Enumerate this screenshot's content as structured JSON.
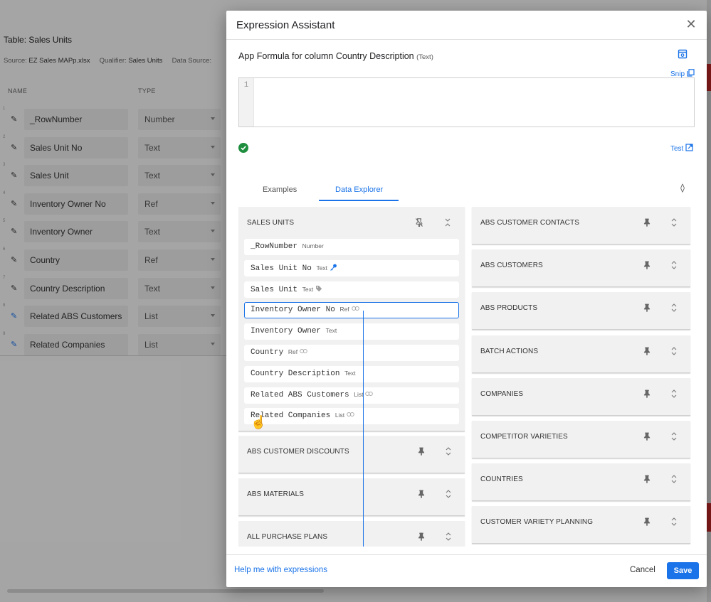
{
  "background": {
    "table_title": "Table: Sales Units",
    "source_label": "Source:",
    "source_value": "EZ Sales MAPp.xlsx",
    "qualifier_label": "Qualifier:",
    "qualifier_value": "Sales Units",
    "data_source_label": "Data Source:",
    "columns_header": {
      "name": "NAME",
      "type": "TYPE"
    },
    "rows": [
      {
        "index": "1",
        "name": "_RowNumber",
        "type": "Number",
        "edit_icon": "pencil-icon"
      },
      {
        "index": "2",
        "name": "Sales Unit No",
        "type": "Text",
        "edit_icon": "pencil-icon"
      },
      {
        "index": "3",
        "name": "Sales Unit",
        "type": "Text",
        "edit_icon": "pencil-icon"
      },
      {
        "index": "4",
        "name": "Inventory Owner No",
        "type": "Ref",
        "edit_icon": "pencil-icon"
      },
      {
        "index": "5",
        "name": "Inventory Owner",
        "type": "Text",
        "edit_icon": "pencil-icon"
      },
      {
        "index": "6",
        "name": "Country",
        "type": "Ref",
        "edit_icon": "pencil-icon"
      },
      {
        "index": "7",
        "name": "Country Description",
        "type": "Text",
        "edit_icon": "pencil-icon"
      },
      {
        "index": "8",
        "name": "Related ABS Customers",
        "type": "List",
        "edit_icon": "pencil-icon-blue"
      },
      {
        "index": "9",
        "name": "Related Companies",
        "type": "List",
        "edit_icon": "pencil-icon-blue"
      }
    ]
  },
  "dialog": {
    "title": "Expression Assistant",
    "close_icon": "close-icon",
    "formula_label": "App Formula for column Country Description",
    "formula_type": "(Text)",
    "snip_label": "Snip",
    "editor_line_number": "1",
    "editor_value": "",
    "status_icon": "check-circle-icon",
    "test_label": "Test",
    "tabs": [
      {
        "label": "Examples",
        "active": false
      },
      {
        "label": "Data Explorer",
        "active": true
      }
    ],
    "collapse_all_icon": "collapse-all-icon",
    "explorer": {
      "left_tables": [
        {
          "title": "SALES UNITS",
          "expanded": true,
          "pinned": true,
          "columns": [
            {
              "name": "_RowNumber",
              "type": "Number",
              "icon": ""
            },
            {
              "name": "Sales Unit No",
              "type": "Text",
              "icon": "key-icon"
            },
            {
              "name": "Sales Unit",
              "type": "Text",
              "icon": "tag-icon"
            },
            {
              "name": "Inventory Owner No",
              "type": "Ref",
              "icon": "link-icon"
            },
            {
              "name": "Inventory Owner",
              "type": "Text",
              "icon": ""
            },
            {
              "name": "Country",
              "type": "Ref",
              "icon": "link-icon"
            },
            {
              "name": "Country Description",
              "type": "Text",
              "icon": ""
            },
            {
              "name": "Related ABS Customers",
              "type": "List",
              "icon": "link-icon"
            },
            {
              "name": "Related Companies",
              "type": "List",
              "icon": "link-icon"
            }
          ]
        },
        {
          "title": "ABS CUSTOMER DISCOUNTS",
          "expanded": false
        },
        {
          "title": "ABS MATERIALS",
          "expanded": false
        },
        {
          "title": "ALL PURCHASE PLANS",
          "expanded": false
        }
      ],
      "right_tables": [
        {
          "title": "ABS CUSTOMER CONTACTS"
        },
        {
          "title": "ABS CUSTOMERS"
        },
        {
          "title": "ABS PRODUCTS"
        },
        {
          "title": "BATCH ACTIONS"
        },
        {
          "title": "COMPANIES"
        },
        {
          "title": "COMPETITOR VARIETIES"
        },
        {
          "title": "COUNTRIES"
        },
        {
          "title": "CUSTOMER VARIETY PLANNING"
        }
      ]
    },
    "footer": {
      "help_label": "Help me with expressions",
      "cancel_label": "Cancel",
      "save_label": "Save"
    }
  },
  "colors": {
    "accent": "#1a73e8",
    "success": "#1e8e3e",
    "card_bg": "#f1f1f1"
  }
}
